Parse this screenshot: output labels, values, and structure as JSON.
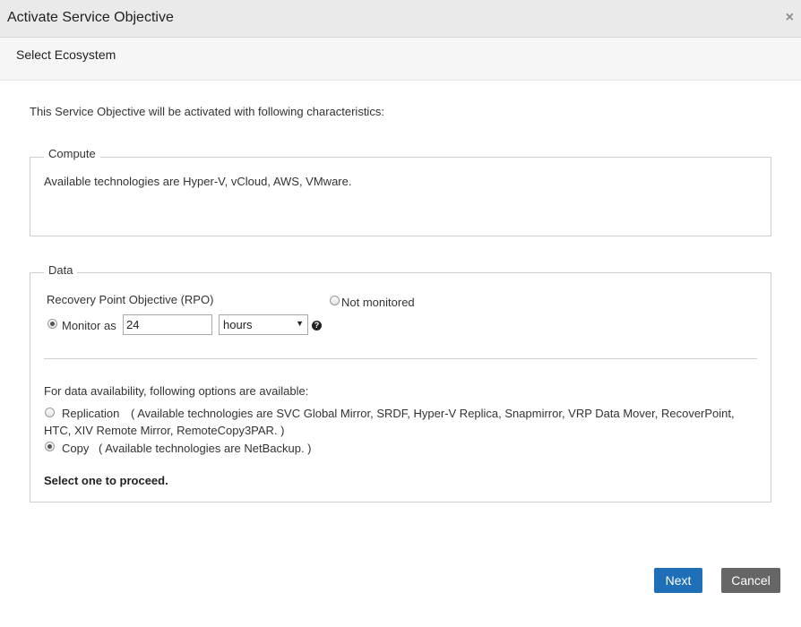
{
  "dialog": {
    "title": "Activate Service Objective",
    "close_label": "×"
  },
  "step": {
    "title": "Select Ecosystem"
  },
  "intro": "This Service Objective will be activated with following characteristics:",
  "compute": {
    "legend": "Compute",
    "text": "Available technologies are Hyper-V, vCloud, AWS, VMware."
  },
  "data_section": {
    "legend": "Data",
    "rpo_label": "Recovery Point Objective (RPO)",
    "not_monitored_label": "Not monitored",
    "monitor_as_label": "Monitor as",
    "rpo_value": "24",
    "unit_selected": "hours",
    "availability_intro": "For data availability, following options are available:",
    "replication_label": "Replication",
    "replication_desc_line1": "( Available technologies are SVC Global Mirror, SRDF, Hyper-V Replica, Snapmirror, VRP Data Mover, RecoverPoint,",
    "replication_desc_line2": "HTC, XIV Remote Mirror, RemoteCopy3PAR. )",
    "copy_label": "Copy",
    "copy_desc": "( Available technologies are NetBackup. )",
    "proceed_note": "Select one to proceed."
  },
  "buttons": {
    "next": "Next",
    "cancel": "Cancel"
  },
  "colors": {
    "primary_button": "#1f6fb8",
    "cancel_button": "#666666",
    "titlebar": "#eaeaea"
  }
}
